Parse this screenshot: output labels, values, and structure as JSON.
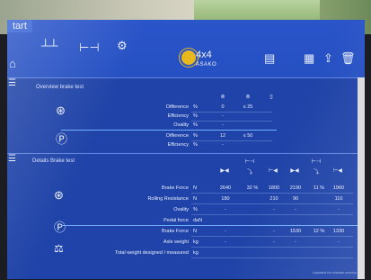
{
  "app": {
    "tab_label": "tart"
  },
  "toolbar": {
    "icons": [
      "lift-icon",
      "axle-icon",
      "settings-icon",
      "drive-mode-icon",
      "printer-icon",
      "report-icon",
      "export-icon",
      "delete-icon"
    ],
    "brand": {
      "main": "4x4",
      "sub": "ASAKO"
    }
  },
  "overview": {
    "title": "Overview brake test",
    "col_values": [
      "0",
      "≤ 25"
    ],
    "rows": [
      {
        "label": "Difference",
        "unit": "%",
        "v1": "0",
        "v2": "≤ 25"
      },
      {
        "label": "Efficiency",
        "unit": "%",
        "v1": "-",
        "v2": ""
      },
      {
        "label": "Ovality",
        "unit": "%",
        "v1": "-",
        "v2": ""
      },
      {
        "label": "Difference",
        "unit": "%",
        "v1": "12",
        "v2": "≤ 50"
      },
      {
        "label": "Efficiency",
        "unit": "%",
        "v1": "-",
        "v2": ""
      }
    ]
  },
  "details": {
    "title": "Details Brake test",
    "rows": [
      {
        "label": "Brake Force",
        "unit": "N",
        "vals": [
          "2640",
          "32 %",
          "1800",
          "2190",
          "11 %",
          "1960"
        ]
      },
      {
        "label": "Rolling Resistance",
        "unit": "N",
        "vals": [
          "180",
          "",
          "210",
          "90",
          "",
          "110"
        ]
      },
      {
        "label": "Ovality",
        "unit": "%",
        "vals": [
          "-",
          "",
          "-",
          "-",
          "",
          "-"
        ]
      },
      {
        "label": "Pedal force",
        "unit": "daN",
        "vals": [
          "",
          "",
          "",
          "",
          "",
          ""
        ]
      },
      {
        "label": "Brake Force",
        "unit": "N",
        "vals": [
          "-",
          "",
          "-",
          "1530",
          "12 %",
          "1330"
        ]
      },
      {
        "label": "Axle weight",
        "unit": "kg",
        "vals": [
          "-",
          "",
          "-",
          "-",
          "",
          "-"
        ]
      },
      {
        "label": "Total weight designed / measured",
        "unit": "kg",
        "vals": [
          "",
          "",
          "",
          "",
          "",
          ""
        ]
      }
    ]
  },
  "footer": {
    "note": "Updated for release version"
  }
}
